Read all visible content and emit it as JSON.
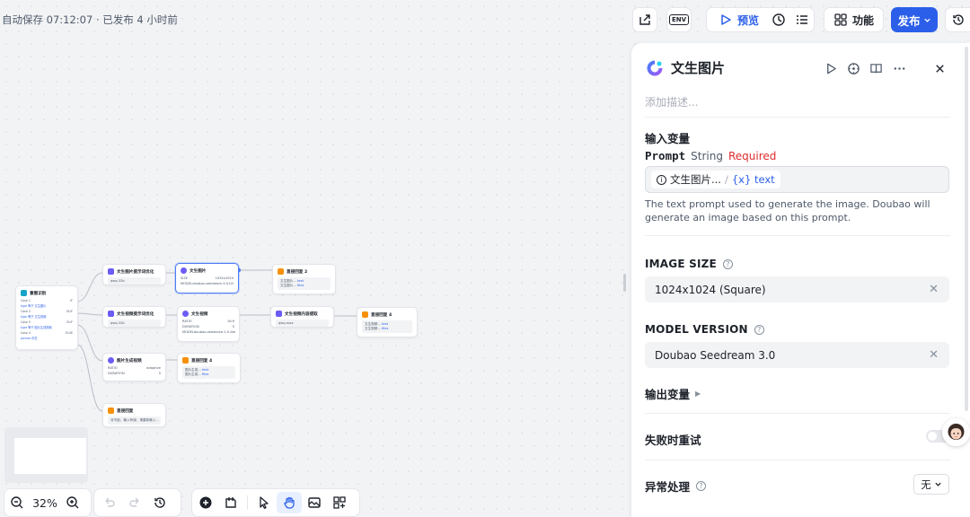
{
  "header": {
    "autosave": "自动保存 07:12:07 · 已发布 4 小时前",
    "env_label": "ENV",
    "preview_label": "预览",
    "features_label": "功能",
    "publish_label": "发布"
  },
  "nodes": {
    "intent": {
      "title": "意图识别",
      "rows": [
        "Case 1",
        "Case 2",
        "Case 3",
        "Case 4"
      ],
      "branches": [
        "IF",
        "ELIF",
        "ELIF",
        "ELSE"
      ],
      "conds": [
        "type 等于 文生图片",
        "type 等于 文生视频",
        "type 等于 图片生成视频",
        "picture 存在"
      ]
    },
    "prompt1": {
      "title": "文生图片提示词优化",
      "body": "qwq-32b"
    },
    "t2i": {
      "title": "文生图片",
      "size_label": "SIZE",
      "size_value": "1024x1024",
      "model_label": "MODEL",
      "model_value": "doubao-seedream-3.0-t2i"
    },
    "reply2": {
      "title": "直接回复 2",
      "line1": "文生图片...",
      "line2": "文生图片...",
      "tag1": "text",
      "tag2": "files"
    },
    "prompt2": {
      "title": "文生视频提示词优化",
      "body": "qwq-32b"
    },
    "t2v": {
      "title": "文生视频",
      "ratio_label": "RATIO",
      "ratio_value": "16:9",
      "dur_label": "DURATION",
      "dur_value": "5",
      "model_label": "MODEL",
      "model_value": "doubao-seedance-1-0-lite"
    },
    "vidopt": {
      "title": "文生视频内容提取",
      "body": "qwq-max"
    },
    "reply4": {
      "title": "直接回复 4",
      "line1": "文生视频...",
      "line2": "文生视频...",
      "tag1": "text",
      "tag2": "files"
    },
    "i2v": {
      "title": "图片生成视频",
      "ratio_label": "RATIO",
      "ratio_value": "adaptive",
      "dur_label": "DURATION",
      "dur_value": "5"
    },
    "reply3": {
      "title": "直接回复 4",
      "line1": "图片生成...",
      "line2": "图片生成...",
      "tag1": "text",
      "tag2": "files"
    },
    "reply1": {
      "title": "直接回复",
      "body": "对不起，输入有误，请重新输入..."
    }
  },
  "bottom": {
    "zoom": "32%"
  },
  "panel": {
    "title": "文生图片",
    "description_placeholder": "添加描述...",
    "input_vars_label": "输入变量",
    "prompt_name": "Prompt",
    "prompt_type": "String",
    "prompt_required": "Required",
    "prompt_chip_node": "文生图片...",
    "prompt_chip_var": "{x} text",
    "prompt_description": "The text prompt used to generate the image. Doubao will generate an image based on this prompt.",
    "image_size_label": "IMAGE SIZE",
    "image_size_value": "1024x1024 (Square)",
    "model_version_label": "MODEL VERSION",
    "model_version_value": "Doubao Seedream 3.0",
    "output_vars_label": "输出变量",
    "retry_label": "失败时重试",
    "retry_enabled": false,
    "error_label": "异常处理",
    "error_value": "无"
  },
  "colors": {
    "accent": "#2b5fea",
    "required": "#e02d2d",
    "llm_node": "#6b5cf6",
    "reply_node": "#f79009",
    "intent_node": "#16a3c7"
  }
}
